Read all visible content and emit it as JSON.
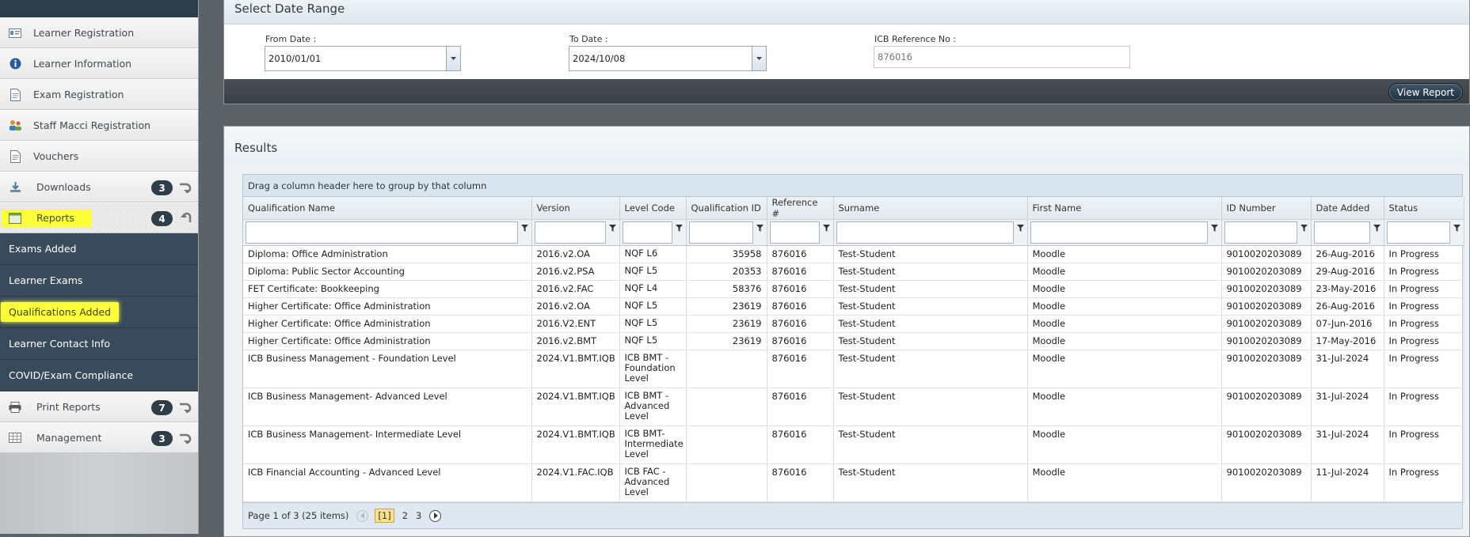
{
  "sidebar": {
    "items": [
      {
        "label": "Learner Registration",
        "icon": "id-card-icon"
      },
      {
        "label": "Learner Information",
        "icon": "info-icon"
      },
      {
        "label": "Exam Registration",
        "icon": "document-icon"
      },
      {
        "label": "Staff Macci Registration",
        "icon": "users-icon"
      },
      {
        "label": "Vouchers",
        "icon": "document-icon"
      },
      {
        "label": "Downloads",
        "icon": "download-icon",
        "badge": "3"
      },
      {
        "label": "Reports",
        "icon": "report-icon",
        "badge": "4"
      }
    ],
    "reports_sub": [
      {
        "label": "Exams Added"
      },
      {
        "label": "Learner Exams"
      },
      {
        "label": "Qualifications Added"
      },
      {
        "label": "Learner Contact Info"
      },
      {
        "label": "COVID/Exam Compliance"
      }
    ],
    "bottom_items": [
      {
        "label": "Print Reports",
        "icon": "printer-icon",
        "badge": "7"
      },
      {
        "label": "Management",
        "icon": "table-icon",
        "badge": "3"
      }
    ]
  },
  "date_range": {
    "title": "Select Date Range",
    "from_label": "From Date :",
    "from_value": "2010/01/01",
    "to_label": "To Date :",
    "to_value": "2024/10/08",
    "ref_label": "ICB Reference No :",
    "ref_value": "876016",
    "view_button": "View Report"
  },
  "results": {
    "title": "Results",
    "group_hint": "Drag a column header here to group by that column",
    "columns": [
      "Qualification Name",
      "Version",
      "Level Code",
      "Qualification ID",
      "Reference #",
      "Surname",
      "First Name",
      "ID Number",
      "Date Added",
      "Status"
    ],
    "rows": [
      [
        "Diploma: Office Administration",
        "2016.v2.OA",
        "NQF L6",
        "35958",
        "876016",
        "Test-Student",
        "Moodle",
        "9010020203089",
        "26-Aug-2016",
        "In Progress"
      ],
      [
        "Diploma: Public Sector Accounting",
        "2016.v2.PSA",
        "NQF L5",
        "20353",
        "876016",
        "Test-Student",
        "Moodle",
        "9010020203089",
        "29-Aug-2016",
        "In Progress"
      ],
      [
        "FET Certificate: Bookkeeping",
        "2016.v2.FAC",
        "NQF L4",
        "58376",
        "876016",
        "Test-Student",
        "Moodle",
        "9010020203089",
        "23-May-2016",
        "In Progress"
      ],
      [
        "Higher Certificate: Office Administration",
        "2016.v2.OA",
        "NQF L5",
        "23619",
        "876016",
        "Test-Student",
        "Moodle",
        "9010020203089",
        "26-Aug-2016",
        "In Progress"
      ],
      [
        "Higher Certificate: Office Administration",
        "2016.V2.ENT",
        "NQF L5",
        "23619",
        "876016",
        "Test-Student",
        "Moodle",
        "9010020203089",
        "07-Jun-2016",
        "In Progress"
      ],
      [
        "Higher Certificate: Office Administration",
        "2016.v2.BMT",
        "NQF L5",
        "23619",
        "876016",
        "Test-Student",
        "Moodle",
        "9010020203089",
        "17-May-2016",
        "In Progress"
      ],
      [
        "ICB Business Management - Foundation Level",
        "2024.V1.BMT.IQB",
        "ICB BMT - Foundation Level",
        "",
        "876016",
        "Test-Student",
        "Moodle",
        "9010020203089",
        "31-Jul-2024",
        "In Progress"
      ],
      [
        "ICB Business Management- Advanced Level",
        "2024.V1.BMT.IQB",
        "ICB BMT - Advanced Level",
        "",
        "876016",
        "Test-Student",
        "Moodle",
        "9010020203089",
        "31-Jul-2024",
        "In Progress"
      ],
      [
        "ICB Business Management- Intermediate Level",
        "2024.V1.BMT.IQB",
        "ICB BMT- Intermediate Level",
        "",
        "876016",
        "Test-Student",
        "Moodle",
        "9010020203089",
        "31-Jul-2024",
        "In Progress"
      ],
      [
        "ICB Financial Accounting - Advanced Level",
        "2024.V1.FAC.IQB",
        "ICB FAC - Advanced Level",
        "",
        "876016",
        "Test-Student",
        "Moodle",
        "9010020203089",
        "11-Jul-2024",
        "In Progress"
      ]
    ],
    "pager": {
      "summary": "Page 1 of 3 (25 items)",
      "current": "[1]",
      "pages": [
        "2",
        "3"
      ]
    }
  },
  "colors": {
    "highlight": "#ffff3a",
    "sidebar_dark": "#394b5a",
    "badge": "#2f3d48"
  }
}
